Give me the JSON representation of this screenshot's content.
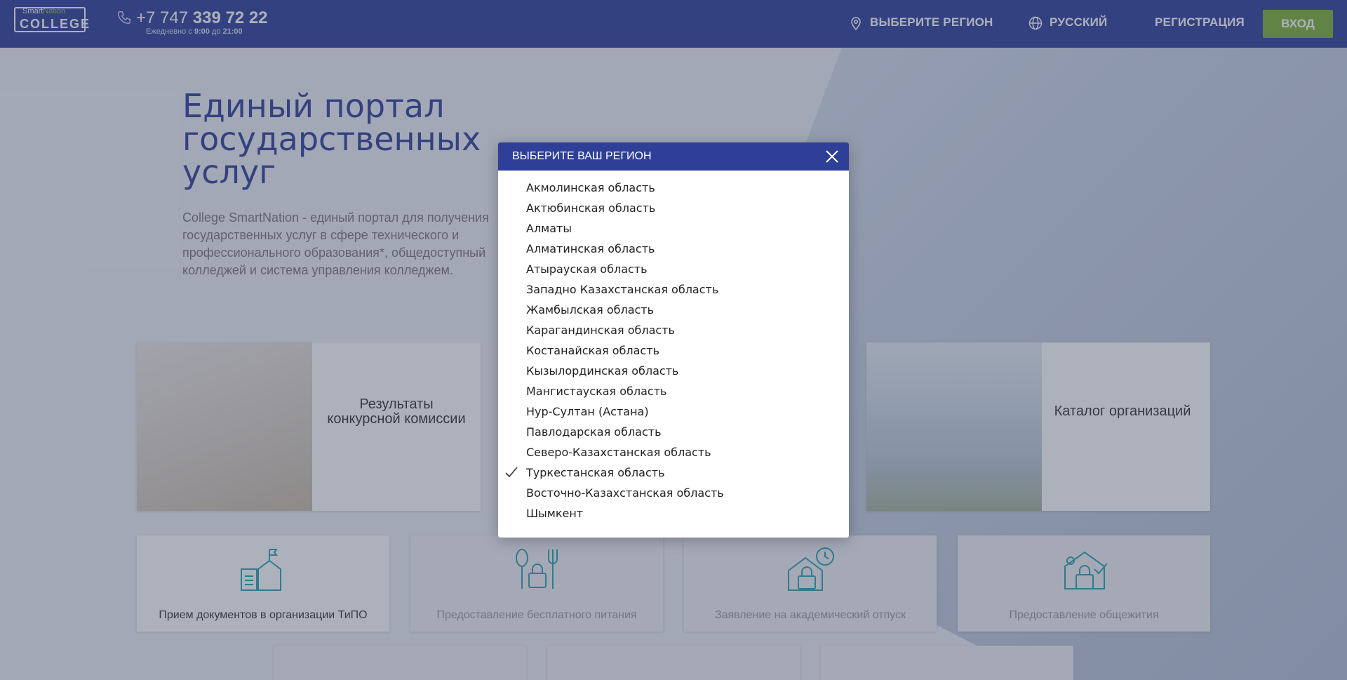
{
  "header": {
    "logo_smart": "Smart",
    "logo_nation": "Nation",
    "logo_college": "COLLEGE",
    "phone_prefix": "+7 747 ",
    "phone_main": "339 72 22",
    "hours_prefix": "Ежедневно с ",
    "hours_from": "9:00",
    "hours_mid": " до ",
    "hours_to": "21:00",
    "nav": {
      "region": "Выберите регион",
      "language": "Русский",
      "register": "Регистрация",
      "login": "Вход"
    }
  },
  "hero": {
    "title": "Единый портал государственных услуг",
    "description": "College SmartNation - единый портал для получения государственных услуг в сфере технического и профессионального образования*, общедоступный колледжей и система управления колледжем."
  },
  "cards": {
    "results": "Результаты конкурсной комиссии",
    "catalog": "Каталог организаций"
  },
  "services": [
    {
      "label": "Прием документов в организации ТиПО",
      "locked": false
    },
    {
      "label": "Предоставление бесплатного питания",
      "locked": true
    },
    {
      "label": "Заявление на академический отпуск",
      "locked": true
    },
    {
      "label": "Предоставление общежития",
      "locked": true
    }
  ],
  "modal": {
    "title": "Выберите ваш регион",
    "selected_index": 14,
    "regions": [
      "Акмолинская область",
      "Актюбинская область",
      "Алматы",
      "Алматинская область",
      "Атырауская область",
      "Западно Казахстанская область",
      "Жамбылская область",
      "Карагандинская область",
      "Костанайская область",
      "Кызылординская область",
      "Мангистауская область",
      "Нур-Султан (Астана)",
      "Павлодарская область",
      "Северо-Казахстанская область",
      "Туркестанская область",
      "Восточно-Казахстанская область",
      "Шымкент"
    ]
  },
  "colors": {
    "brand": "#2f3f98",
    "accent_green": "#7db134",
    "service_icon": "#29a3b0"
  },
  "icons": {
    "phone": "phone-icon",
    "region": "map-pin-icon",
    "language": "globe-icon",
    "close": "close-icon",
    "selected": "check-icon"
  }
}
